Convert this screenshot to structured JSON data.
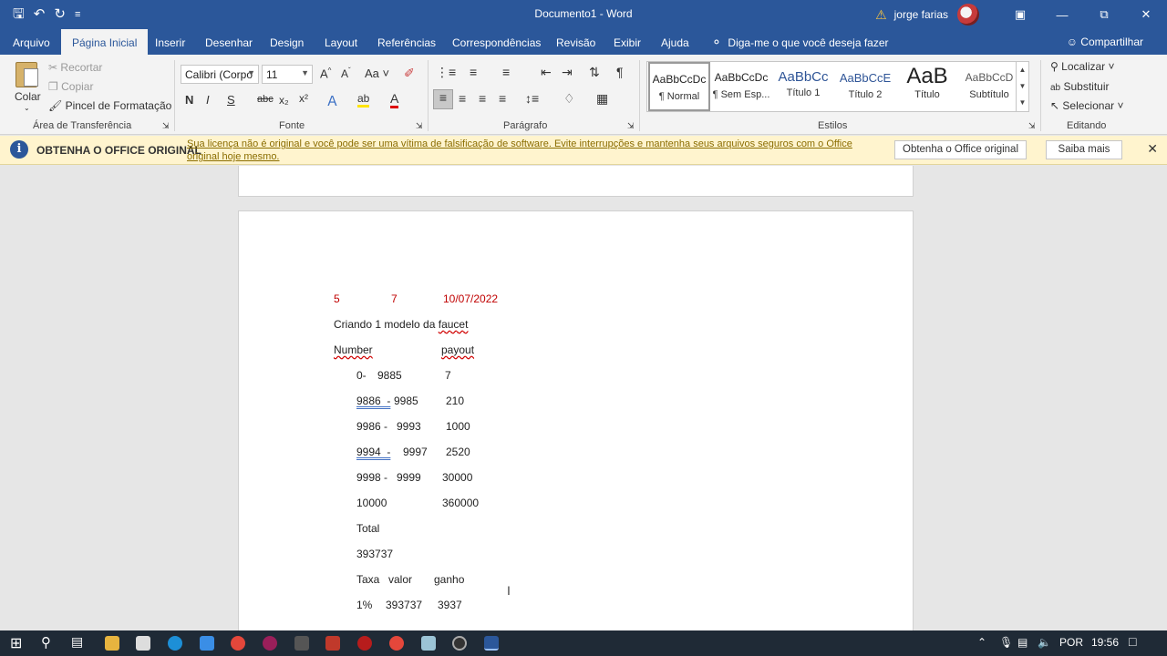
{
  "titlebar": {
    "document_title": "Documento1 - Word",
    "user": "jorge farias",
    "qat_icons": [
      "save-icon",
      "undo-icon",
      "redo-icon",
      "customize-icon"
    ]
  },
  "tabs": [
    "Arquivo",
    "Página Inicial",
    "Inserir",
    "Desenhar",
    "Design",
    "Layout",
    "Referências",
    "Correspondências",
    "Revisão",
    "Exibir",
    "Ajuda"
  ],
  "active_tab": "Página Inicial",
  "tell_me": "Diga-me o que você deseja fazer",
  "share": "Compartilhar",
  "clipboard": {
    "paste": "Colar",
    "cut": "Recortar",
    "copy": "Copiar",
    "format_painter": "Pincel de Formatação",
    "label": "Área de Transferência"
  },
  "font": {
    "name": "Calibri (Corpo",
    "size": "11",
    "label": "Fonte",
    "bold": "N",
    "italic": "I",
    "underline": "S",
    "strike": "abc",
    "subscript": "x₂",
    "superscript": "x²"
  },
  "paragraph": {
    "label": "Parágrafo"
  },
  "styles": {
    "label": "Estilos",
    "items": [
      {
        "sample": "AaBbCcDc",
        "name": "¶ Normal"
      },
      {
        "sample": "AaBbCcDc",
        "name": "¶ Sem Esp..."
      },
      {
        "sample": "AaBbCc",
        "name": "Título 1"
      },
      {
        "sample": "AaBbCcE",
        "name": "Título 2"
      },
      {
        "sample": "AaB",
        "name": "Título"
      },
      {
        "sample": "AaBbCcD",
        "name": "Subtítulo"
      }
    ]
  },
  "editing": {
    "label": "Editando",
    "find": "Localizar",
    "replace": "Substituir",
    "select": "Selecionar"
  },
  "notification": {
    "title": "OBTENHA O OFFICE ORIGINAL",
    "message": "Sua licença não é original e você pode ser uma vítima de falsificação de software. Evite interrupções e mantenha seus arquivos seguros com o Office original hoje mesmo.",
    "button_primary": "Obtenha o Office original",
    "button_secondary": "Saiba mais"
  },
  "document": {
    "header_line": {
      "a": "5",
      "b": "7",
      "c": "10/07/2022"
    },
    "line1_prefix": "Criando 1 modelo da ",
    "line1_word": "faucet",
    "col_number": "Number",
    "col_payout": "payout",
    "rows": [
      {
        "range_a": "0-",
        "range_b": "9885",
        "payout": "7"
      },
      {
        "range_a": "9886  -",
        "range_b": "9985",
        "payout": "210"
      },
      {
        "range_a": "9986 -",
        "range_b": "9993",
        "payout": "1000"
      },
      {
        "range_a": "9994  -",
        "range_b": "9997",
        "payout": "2520"
      },
      {
        "range_a": "9998 -",
        "range_b": "9999",
        "payout": "30000"
      },
      {
        "range_a": "10000",
        "range_b": "",
        "payout": "360000"
      }
    ],
    "total_label": "Total",
    "total_value": "393737",
    "tax_header": {
      "a": "Taxa",
      "b": "valor",
      "c": "ganho"
    },
    "tax_row": {
      "a": "1%",
      "b": "393737",
      "c": "3937"
    }
  },
  "taskbar": {
    "language": "POR",
    "time": "19:56"
  }
}
